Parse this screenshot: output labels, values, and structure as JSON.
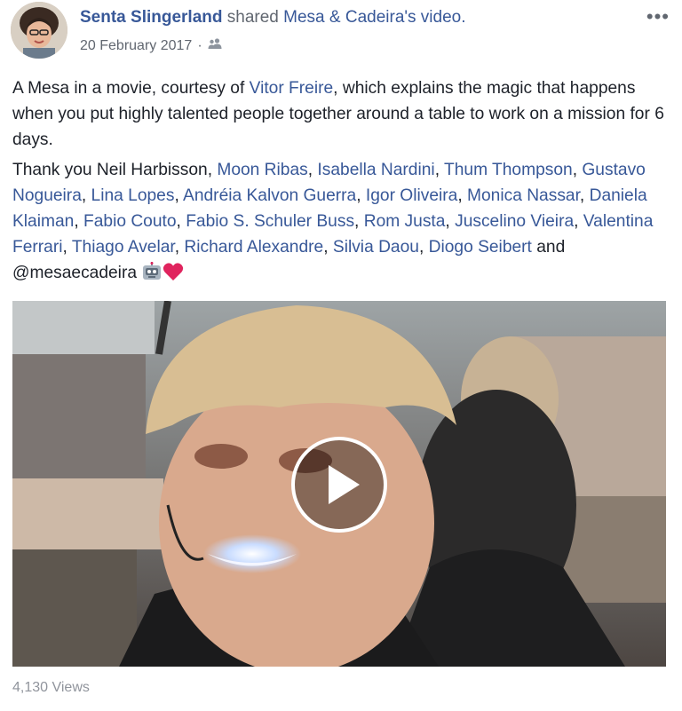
{
  "post": {
    "author": "Senta Slingerland",
    "shared_text": "shared",
    "page_name": "Mesa & Cadeira's video.",
    "date": "20 February 2017",
    "separator": "·",
    "audience_icon": "friends-icon",
    "more_icon": "more-options-icon",
    "more_glyph": "•••"
  },
  "body": {
    "p1": {
      "before": "A Mesa in a movie, courtesy of ",
      "link": "Vitor Freire",
      "after": ", which explains the magic that happens when you put highly talented people together around a table to work on a mission for 6 days."
    },
    "p2": {
      "intro": "Thank you Neil Harbisson, ",
      "people": [
        "Moon Ribas",
        "Isabella Nardini",
        "Thum Thompson",
        "Gustavo Nogueira",
        "Lina Lopes",
        "Andréia Kalvon Guerra",
        "Igor Oliveira",
        "Monica Nassar",
        "Daniela Klaiman",
        "Fabio Couto",
        "Fabio S. Schuler Buss",
        "Rom Justa",
        "Juscelino Vieira",
        "Valentina Ferrari",
        "Thiago Avelar",
        "Richard Alexandre",
        "Silvia Daou",
        "Diogo Seibert"
      ],
      "comma": ", ",
      "and": " and ",
      "handle": "@mesaecadeira",
      "emojis": [
        "robot-emoji",
        "heart-emoji"
      ]
    }
  },
  "video": {
    "play_icon": "play-icon",
    "views": "4,130 Views"
  },
  "colors": {
    "link": "#385898",
    "text": "#1d2129",
    "meta": "#616770",
    "views": "#90949c",
    "heart": "#e0245e"
  }
}
